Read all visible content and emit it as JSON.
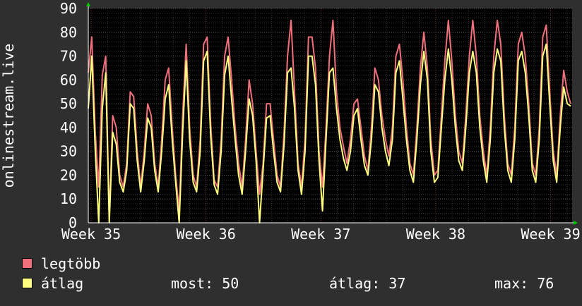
{
  "chart_data": {
    "type": "line",
    "ylabel": "onlinestream.live",
    "ylim": [
      0,
      90
    ],
    "yticks": [
      0,
      10,
      20,
      30,
      40,
      50,
      60,
      70,
      80,
      90
    ],
    "x_tick_labels": [
      "Week 35",
      "Week 36",
      "Week 37",
      "Week 38",
      "Week 39"
    ],
    "grid": true,
    "legend_placement": "bottom",
    "series": [
      {
        "name": "legtöbb",
        "color": "#f0707b",
        "values": [
          63,
          78,
          38,
          15,
          62,
          70,
          2,
          45,
          40,
          20,
          15,
          25,
          55,
          53,
          30,
          15,
          30,
          50,
          45,
          25,
          15,
          35,
          60,
          65,
          40,
          20,
          5,
          45,
          75,
          40,
          20,
          15,
          35,
          75,
          78,
          42,
          18,
          15,
          35,
          70,
          78,
          60,
          40,
          25,
          15,
          35,
          60,
          50,
          30,
          12,
          25,
          50,
          50,
          35,
          20,
          15,
          38,
          70,
          85,
          55,
          25,
          15,
          35,
          78,
          78,
          65,
          30,
          15,
          40,
          70,
          85,
          55,
          40,
          32,
          25,
          35,
          50,
          52,
          40,
          28,
          22,
          40,
          65,
          60,
          45,
          35,
          28,
          40,
          70,
          75,
          60,
          40,
          25,
          20,
          40,
          65,
          80,
          65,
          35,
          20,
          22,
          45,
          68,
          85,
          68,
          45,
          30,
          25,
          45,
          70,
          85,
          70,
          45,
          30,
          20,
          40,
          70,
          85,
          75,
          45,
          25,
          20,
          40,
          75,
          80,
          70,
          50,
          25,
          20,
          40,
          78,
          83,
          55,
          30,
          20,
          45,
          64,
          55,
          50
        ]
      },
      {
        "name": "átlag",
        "color": "#ffff80",
        "values": [
          48,
          70,
          30,
          0,
          48,
          63,
          0,
          38,
          33,
          17,
          13,
          22,
          50,
          48,
          26,
          13,
          26,
          44,
          40,
          22,
          13,
          30,
          52,
          58,
          35,
          17,
          0,
          38,
          68,
          35,
          17,
          13,
          30,
          68,
          72,
          37,
          16,
          12,
          30,
          62,
          70,
          52,
          35,
          20,
          12,
          30,
          52,
          45,
          26,
          0,
          22,
          44,
          45,
          30,
          17,
          13,
          33,
          63,
          65,
          48,
          22,
          12,
          30,
          70,
          70,
          58,
          26,
          5,
          35,
          63,
          65,
          48,
          35,
          27,
          22,
          30,
          45,
          48,
          35,
          24,
          20,
          35,
          58,
          55,
          40,
          30,
          24,
          35,
          63,
          68,
          52,
          35,
          22,
          17,
          35,
          58,
          72,
          60,
          30,
          17,
          19,
          40,
          60,
          73,
          60,
          40,
          26,
          22,
          40,
          63,
          72,
          63,
          40,
          26,
          17,
          35,
          63,
          73,
          68,
          40,
          22,
          17,
          35,
          68,
          72,
          63,
          45,
          22,
          17,
          35,
          70,
          75,
          50,
          26,
          17,
          40,
          57,
          50,
          49
        ]
      }
    ]
  },
  "legend": {
    "items": [
      {
        "label": "legtöbb",
        "color": "#f0707b"
      },
      {
        "label": "átlag",
        "color": "#ffff80"
      }
    ],
    "stats": {
      "now": "most: 50",
      "avg": "átlag: 37",
      "max": "max: 76"
    }
  },
  "colors": {
    "background": "#2f2f2f",
    "plot_bg": "#000000",
    "grid": "#5a5a5a",
    "arrow": "#00cc00"
  }
}
